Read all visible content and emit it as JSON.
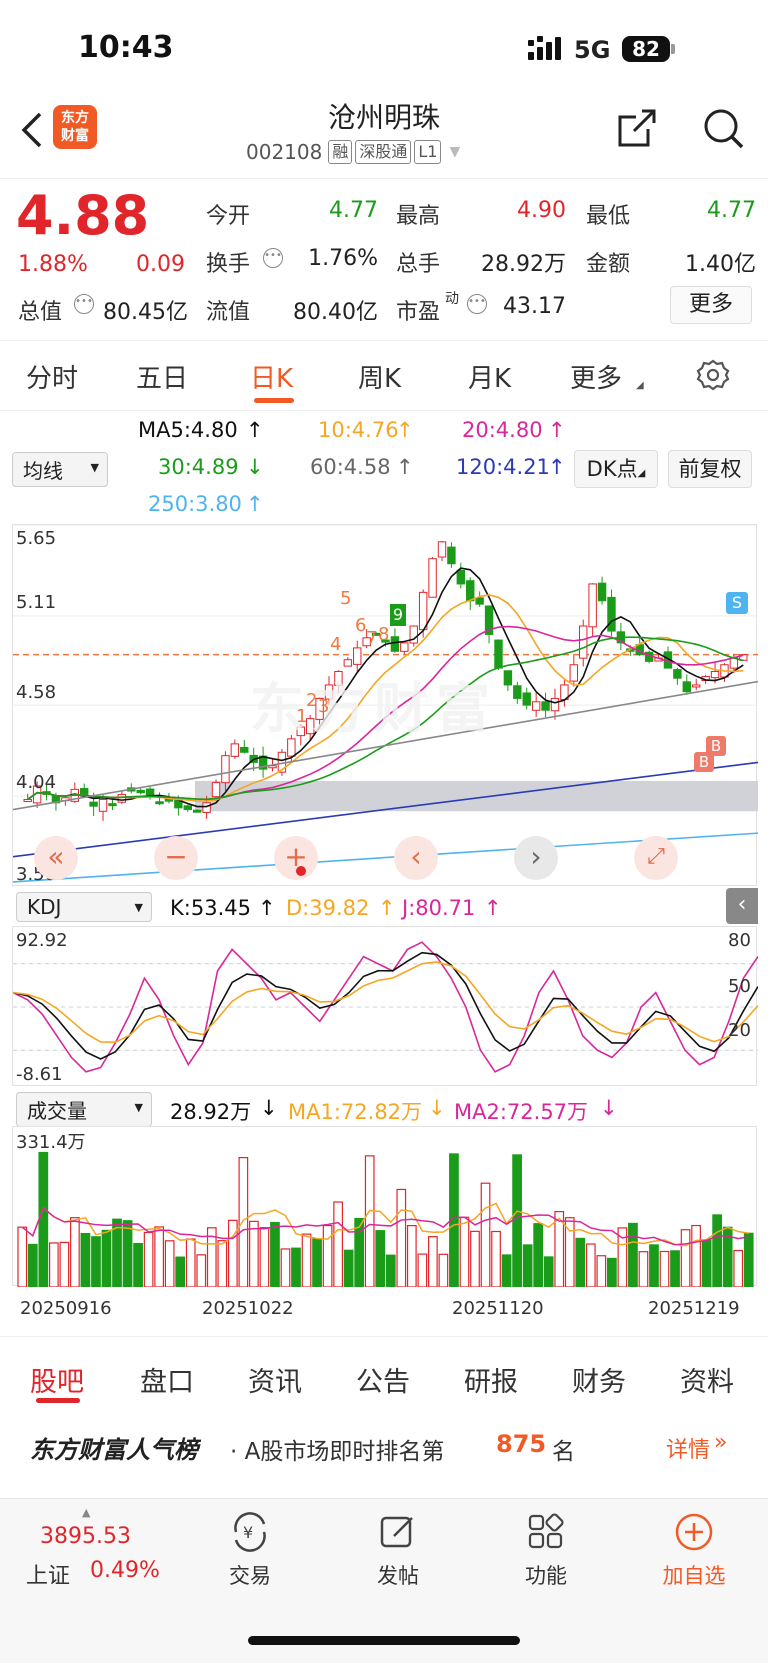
{
  "status_bar": {
    "time": "10:43",
    "network": "5G",
    "battery": "82"
  },
  "header": {
    "logo_top": "东方",
    "logo_bottom": "财富",
    "title": "沧州明珠",
    "code": "002108",
    "tags": [
      "融",
      "深股通",
      "L1"
    ]
  },
  "quote": {
    "price": "4.88",
    "change_pct": "1.88%",
    "change": "0.09",
    "items": [
      {
        "label": "今开",
        "value": "4.77",
        "color": "green"
      },
      {
        "label": "最高",
        "value": "4.90",
        "color": "red"
      },
      {
        "label": "最低",
        "value": "4.77",
        "color": "green"
      },
      {
        "label": "换手",
        "value": "1.76%",
        "color": "dark"
      },
      {
        "label": "总手",
        "value": "28.92万",
        "color": "dark"
      },
      {
        "label": "金额",
        "value": "1.40亿",
        "color": "dark"
      },
      {
        "label": "总值",
        "value": "80.45亿",
        "color": "dark"
      },
      {
        "label": "流值",
        "value": "80.40亿",
        "color": "dark"
      },
      {
        "label": "市盈",
        "value": "43.17",
        "color": "dark"
      }
    ],
    "pe_sup": "动",
    "more_button": "更多"
  },
  "chart_tabs": [
    "分时",
    "五日",
    "日K",
    "周K",
    "月K",
    "更多"
  ],
  "active_tab": "日K",
  "ma": {
    "selector": "均线",
    "ma5": "MA5:4.80",
    "ma10": "10:4.76",
    "ma20": "20:4.80",
    "ma30": "30:4.89",
    "ma60": "60:4.58",
    "ma120": "120:4.21",
    "ma250": "250:3.80",
    "dk_button": "DK点",
    "fq_button": "前复权"
  },
  "kline": {
    "y_labels": [
      "5.65",
      "5.11",
      "4.58",
      "4.04",
      "3.50"
    ],
    "signal_s": "S",
    "signal_b": "B",
    "watermark": "东方财富",
    "markers": [
      "1",
      "2",
      "3",
      "4",
      "5",
      "6",
      "7",
      "8",
      "9"
    ]
  },
  "kdj": {
    "selector": "KDJ",
    "k": "K:53.45",
    "d": "D:39.82",
    "j": "J:80.71",
    "y_top": "92.92",
    "y_bottom": "-8.61",
    "r80": "80",
    "r50": "50",
    "r20": "20"
  },
  "volume": {
    "selector": "成交量",
    "value": "28.92万",
    "ma1": "MA1:72.82万",
    "ma2": "MA2:72.57万",
    "y_top": "331.4万",
    "dates": [
      "20250916",
      "20251022",
      "20251120",
      "20251219"
    ]
  },
  "bottom_tabs": [
    "股吧",
    "盘口",
    "资讯",
    "公告",
    "研报",
    "财务",
    "资料"
  ],
  "rank": {
    "brand": "东方财富人气榜",
    "text_prefix": "· A股市场即时排名第",
    "rank": "875",
    "text_suffix": "名",
    "details": "详情"
  },
  "index": {
    "value": "3895.53",
    "name": "上证",
    "pct": "0.49%"
  },
  "bottom_nav": [
    "交易",
    "发帖",
    "功能",
    "加自选"
  ],
  "chart_data": {
    "type": "candlestick",
    "ylim": [
      3.5,
      5.65
    ],
    "price_labels": [
      "5.65",
      "5.11",
      "4.58",
      "4.04",
      "3.50"
    ],
    "current_price": 4.88
  }
}
